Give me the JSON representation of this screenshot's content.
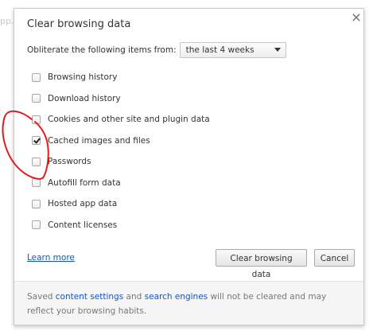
{
  "background": {
    "text": "pp.l"
  },
  "dialog": {
    "title": "Clear browsing data",
    "close_glyph": "×",
    "period_label": "Obliterate the following items from:",
    "period_value": "the last 4 weeks",
    "options": [
      {
        "label": "Browsing history",
        "checked": false
      },
      {
        "label": "Download history",
        "checked": false
      },
      {
        "label": "Cookies and other site and plugin data",
        "checked": false
      },
      {
        "label": "Cached images and files",
        "checked": true
      },
      {
        "label": "Passwords",
        "checked": false
      },
      {
        "label": "Autofill form data",
        "checked": false
      },
      {
        "label": "Hosted app data",
        "checked": false
      },
      {
        "label": "Content licenses",
        "checked": false
      }
    ],
    "learn_more": "Learn more",
    "clear_button": "Clear browsing data",
    "cancel_button": "Cancel"
  },
  "footer": {
    "prefix": "Saved ",
    "link1": "content settings",
    "middle": " and ",
    "link2": "search engines",
    "suffix": " will not be cleared and may reflect your browsing habits."
  },
  "colors": {
    "link": "#1155cc",
    "annotation": "#e41b1b",
    "footer_bg": "#f5f5f5"
  },
  "icons": {
    "close": "close-icon",
    "dropdown": "chevron-down-icon",
    "checkmark": "checkmark-icon"
  }
}
